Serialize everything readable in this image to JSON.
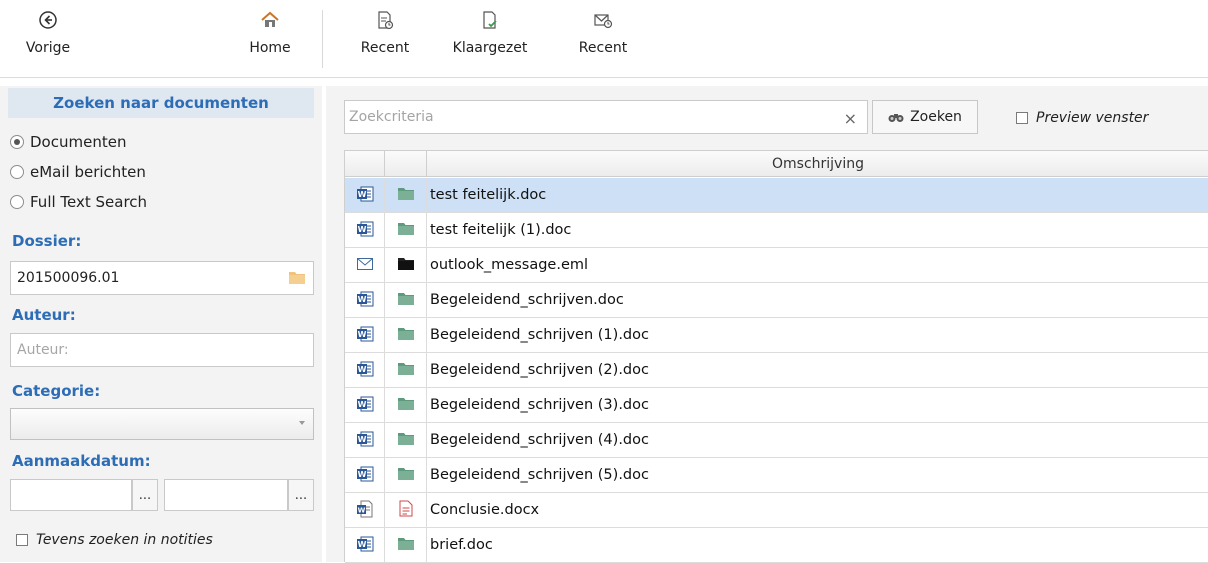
{
  "toolbar": {
    "back": {
      "label": "Vorige",
      "icon": "back-arrow-icon"
    },
    "home": {
      "label": "Home",
      "icon": "home-icon"
    },
    "recent_docs": {
      "label": "Recent",
      "icon": "recent-document-icon"
    },
    "prepared": {
      "label": "Klaargezet",
      "icon": "prepared-document-icon"
    },
    "recent_mail": {
      "label": "Recent",
      "icon": "recent-mail-icon"
    }
  },
  "left": {
    "header": "Zoeken naar documenten",
    "search_types": [
      {
        "label": "Documenten",
        "selected": true
      },
      {
        "label": "eMail berichten",
        "selected": false
      },
      {
        "label": "Full Text Search",
        "selected": false
      }
    ],
    "dossier": {
      "label": "Dossier:",
      "value": "201500096.01"
    },
    "auteur": {
      "label": "Auteur:",
      "placeholder": "Auteur:"
    },
    "categorie": {
      "label": "Categorie:",
      "value": ""
    },
    "aanmaakdatum": {
      "label": "Aanmaakdatum:",
      "from": "",
      "to": "",
      "picker_label": "..."
    },
    "notes_option": {
      "label": "Tevens zoeken in notities",
      "checked": false
    }
  },
  "search": {
    "placeholder": "Zoekcriteria",
    "clear_label": "×",
    "button_label": "Zoeken",
    "preview_label": "Preview venster",
    "preview_checked": false
  },
  "grid": {
    "column_header": "Omschrijving",
    "rows": [
      {
        "name": "test feitelijk.doc",
        "type_icon": "word-icon",
        "status_icon": "folder-green-icon",
        "selected": true
      },
      {
        "name": "test feitelijk (1).doc",
        "type_icon": "word-icon",
        "status_icon": "folder-green-icon",
        "selected": false
      },
      {
        "name": "outlook_message.eml",
        "type_icon": "mail-icon",
        "status_icon": "folder-black-icon",
        "selected": false
      },
      {
        "name": "Begeleidend_schrijven.doc",
        "type_icon": "word-icon",
        "status_icon": "folder-green-icon",
        "selected": false
      },
      {
        "name": "Begeleidend_schrijven (1).doc",
        "type_icon": "word-icon",
        "status_icon": "folder-green-icon",
        "selected": false
      },
      {
        "name": "Begeleidend_schrijven (2).doc",
        "type_icon": "word-icon",
        "status_icon": "folder-green-icon",
        "selected": false
      },
      {
        "name": "Begeleidend_schrijven (3).doc",
        "type_icon": "word-icon",
        "status_icon": "folder-green-icon",
        "selected": false
      },
      {
        "name": "Begeleidend_schrijven (4).doc",
        "type_icon": "word-icon",
        "status_icon": "folder-green-icon",
        "selected": false
      },
      {
        "name": "Begeleidend_schrijven (5).doc",
        "type_icon": "word-icon",
        "status_icon": "folder-green-icon",
        "selected": false
      },
      {
        "name": "Conclusie.docx",
        "type_icon": "word-doc-icon",
        "status_icon": "document-red-icon",
        "selected": false
      },
      {
        "name": "brief.doc",
        "type_icon": "word-icon",
        "status_icon": "folder-green-icon",
        "selected": false
      }
    ]
  },
  "colors": {
    "accent": "#2d6db5",
    "selected_row": "#cde0f6",
    "panel_bg": "#f3f3f3",
    "header_bg": "#dfe7f1",
    "folder_green": "#5f9a7e",
    "word_blue": "#2b5797"
  }
}
